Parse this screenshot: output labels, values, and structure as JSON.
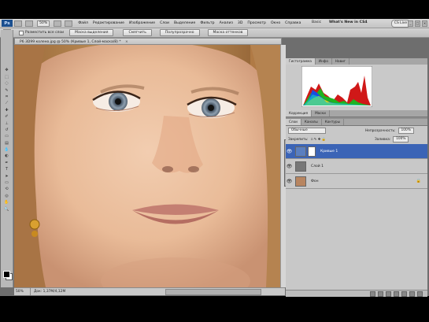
{
  "menu": {
    "logo": "Ps",
    "items": [
      "Файл",
      "Редактирование",
      "Изображение",
      "Слои",
      "Выделение",
      "Фильтр",
      "Анализ",
      "3D",
      "Просмотр",
      "Окно",
      "Справка"
    ],
    "zoom": "50%",
    "workspace_basic": "Basic",
    "whats_new": "What's New in CS4",
    "cslive": "CS Live",
    "window_controls": [
      "_",
      "□",
      "×"
    ]
  },
  "options": {
    "checkbox_label": "Разместить все слои",
    "btn_mask": "Маска выделения",
    "btn_soften": "Смягчить",
    "btn_half": "Полупрозрачно",
    "btn_color": "Маска оттенков"
  },
  "document": {
    "tab_title": "P6 3D99 колено.jpg @ 50% (Кривые 1, Слой-маска/8) *",
    "close": "×",
    "status_zoom": "50%",
    "status_doc": "Док: 1,37M/4,12M"
  },
  "panels": {
    "histogram_tabs": [
      "Гистограмма",
      "Инфо",
      "Навиг"
    ],
    "layers_tabs": [
      "Коррекция",
      "Маски"
    ],
    "layers_tabs2": [
      "Слои",
      "Каналы",
      "Контуры"
    ],
    "blend_mode": "Обычные",
    "opacity_label": "Непрозрачность:",
    "opacity_value": "100%",
    "lock_label": "Закрепить:",
    "fill_label": "Заливка:",
    "fill_value": "100%",
    "layers": [
      {
        "name": "Кривые 1",
        "selected": true,
        "thumb": "#5a7fc0"
      },
      {
        "name": "Слой 1",
        "selected": false,
        "thumb": "#777777"
      },
      {
        "name": "Фон",
        "selected": false,
        "thumb": "#b88560",
        "locked": true
      }
    ]
  },
  "colors": {
    "selection": "#3b64b6",
    "chrome": "#c8c8c8"
  }
}
